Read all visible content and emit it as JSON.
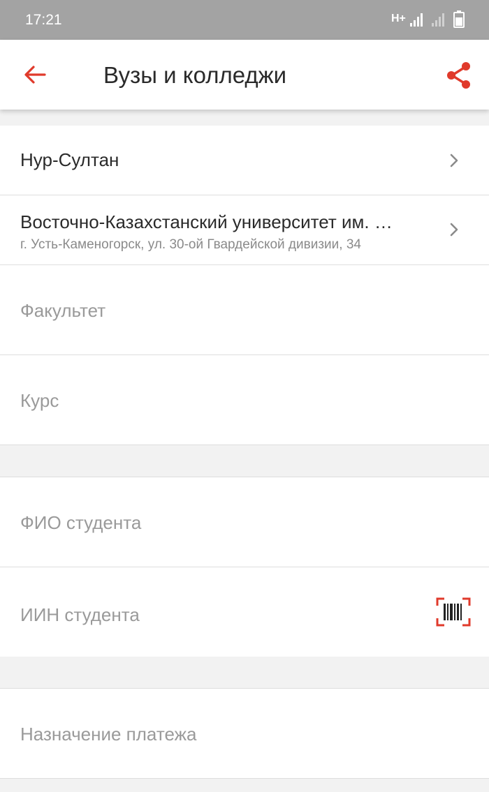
{
  "status_bar": {
    "time": "17:21",
    "network": "H+"
  },
  "app_bar": {
    "title": "Вузы и колледжи",
    "back_icon": "arrow-back-icon",
    "share_icon": "share-icon",
    "accent_color": "#e03a2b"
  },
  "form": {
    "city": {
      "label": "Нур-Султан",
      "icon": "chevron-right-icon"
    },
    "university": {
      "name": "Восточно-Казахстанский университет им. …",
      "address": "г. Усть-Каменогорск, ул. 30-ой Гвардейской дивизии, 34",
      "icon": "chevron-right-icon"
    },
    "faculty": {
      "placeholder": "Факультет"
    },
    "course": {
      "placeholder": "Курс"
    },
    "student_name": {
      "placeholder": "ФИО студента"
    },
    "student_iin": {
      "placeholder": "ИИН студента",
      "icon": "barcode-scan-icon"
    },
    "payment_purpose": {
      "placeholder": "Назначение платежа"
    }
  }
}
